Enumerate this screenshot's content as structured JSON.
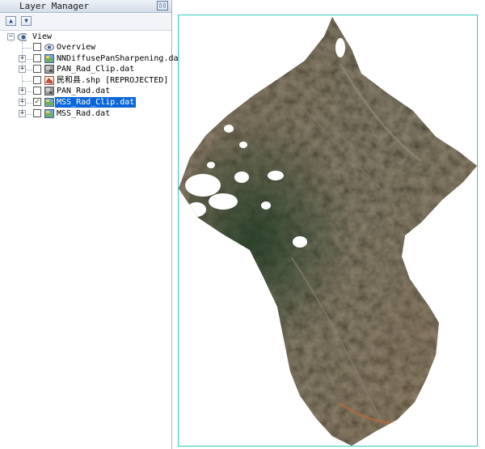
{
  "panel": {
    "title": "Layer Manager",
    "pin_icon": "dock-pin-icon"
  },
  "toolbar": {
    "up_icon": "move-up-icon",
    "down_icon": "move-down-icon"
  },
  "tree": {
    "root": {
      "label": "View",
      "expander": "−"
    },
    "items": [
      {
        "label": "Overview",
        "expander": "",
        "checked": false,
        "icon": "overview-icon",
        "selected": false
      },
      {
        "label": "NNDiffusePanSharpening.dat",
        "expander": "+",
        "checked": false,
        "icon": "raster-color-icon",
        "selected": false
      },
      {
        "label": "PAN_Rad_Clip.dat",
        "expander": "+",
        "checked": false,
        "icon": "raster-gray-icon",
        "selected": false
      },
      {
        "label": "民和县.shp [REPROJECTED]",
        "expander": "",
        "checked": false,
        "icon": "vector-shapefile-icon",
        "selected": false
      },
      {
        "label": "PAN_Rad.dat",
        "expander": "+",
        "checked": false,
        "icon": "raster-gray-icon",
        "selected": false
      },
      {
        "label": "MSS_Rad_Clip.dat",
        "expander": "+",
        "checked": true,
        "icon": "raster-color-icon",
        "selected": true
      },
      {
        "label": "MSS_Rad.dat",
        "expander": "+",
        "checked": false,
        "icon": "raster-color-icon",
        "selected": false
      }
    ]
  },
  "colors": {
    "selection": "#0a66d8",
    "view_border": "#36c8c8",
    "terrain_dark": "#3a3a2c",
    "terrain_brown": "#6b5a44",
    "vegetation": "#2c3d2a"
  }
}
